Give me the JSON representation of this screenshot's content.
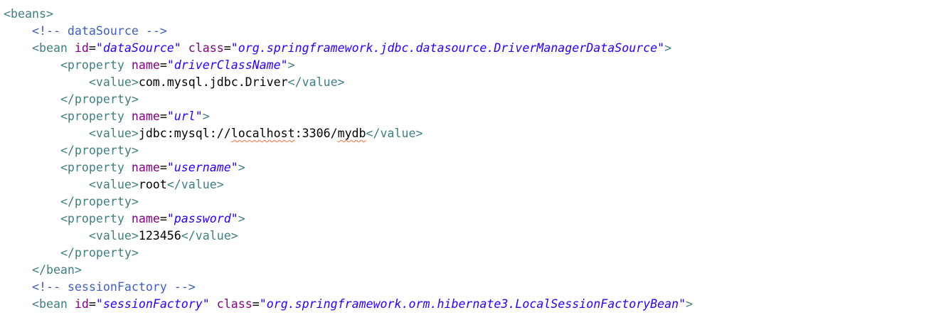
{
  "editor": {
    "lines": [
      [
        {
          "t": "tag",
          "v": "<beans>"
        }
      ],
      [
        {
          "t": "ws",
          "v": "    "
        },
        {
          "t": "comment",
          "v": "<!-- dataSource -->"
        }
      ],
      [
        {
          "t": "ws",
          "v": "    "
        },
        {
          "t": "tag",
          "v": "<bean "
        },
        {
          "t": "attr",
          "v": "id"
        },
        {
          "t": "text",
          "v": "="
        },
        {
          "t": "str",
          "v": "\"dataSource\""
        },
        {
          "t": "ws",
          "v": " "
        },
        {
          "t": "attr",
          "v": "class"
        },
        {
          "t": "text",
          "v": "="
        },
        {
          "t": "str",
          "v": "\"org.springframework.jdbc.datasource.DriverManagerDataSource\""
        },
        {
          "t": "tag",
          "v": ">"
        }
      ],
      [
        {
          "t": "ws",
          "v": "        "
        },
        {
          "t": "tag",
          "v": "<property "
        },
        {
          "t": "attr",
          "v": "name"
        },
        {
          "t": "text",
          "v": "="
        },
        {
          "t": "str",
          "v": "\"driverClassName\""
        },
        {
          "t": "tag",
          "v": ">"
        }
      ],
      [
        {
          "t": "ws",
          "v": "            "
        },
        {
          "t": "tag",
          "v": "<value>"
        },
        {
          "t": "text",
          "v": "com.mysql.jdbc.Driver"
        },
        {
          "t": "tag",
          "v": "</value>"
        }
      ],
      [
        {
          "t": "ws",
          "v": "        "
        },
        {
          "t": "tag",
          "v": "</property>"
        }
      ],
      [
        {
          "t": "ws",
          "v": "        "
        },
        {
          "t": "tag",
          "v": "<property "
        },
        {
          "t": "attr",
          "v": "name"
        },
        {
          "t": "text",
          "v": "="
        },
        {
          "t": "str",
          "v": "\"url\""
        },
        {
          "t": "tag",
          "v": ">"
        }
      ],
      [
        {
          "t": "ws",
          "v": "            "
        },
        {
          "t": "tag",
          "v": "<value>"
        },
        {
          "t": "text",
          "v": "jdbc:mysql://"
        },
        {
          "t": "spell",
          "v": "localhost"
        },
        {
          "t": "text",
          "v": ":3306/"
        },
        {
          "t": "spell",
          "v": "mydb"
        },
        {
          "t": "tag",
          "v": "</value>"
        }
      ],
      [
        {
          "t": "ws",
          "v": "        "
        },
        {
          "t": "tag",
          "v": "</property>"
        }
      ],
      [
        {
          "t": "ws",
          "v": "        "
        },
        {
          "t": "tag",
          "v": "<property "
        },
        {
          "t": "attr",
          "v": "name"
        },
        {
          "t": "text",
          "v": "="
        },
        {
          "t": "str",
          "v": "\"username\""
        },
        {
          "t": "tag",
          "v": ">"
        }
      ],
      [
        {
          "t": "ws",
          "v": "            "
        },
        {
          "t": "tag",
          "v": "<value>"
        },
        {
          "t": "text",
          "v": "root"
        },
        {
          "t": "tag",
          "v": "</value>"
        }
      ],
      [
        {
          "t": "ws",
          "v": "        "
        },
        {
          "t": "tag",
          "v": "</property>"
        }
      ],
      [
        {
          "t": "ws",
          "v": "        "
        },
        {
          "t": "tag",
          "v": "<property "
        },
        {
          "t": "attr",
          "v": "name"
        },
        {
          "t": "text",
          "v": "="
        },
        {
          "t": "str",
          "v": "\"password\""
        },
        {
          "t": "tag",
          "v": ">"
        }
      ],
      [
        {
          "t": "ws",
          "v": "            "
        },
        {
          "t": "tag",
          "v": "<value>"
        },
        {
          "t": "text",
          "v": "123456"
        },
        {
          "t": "tag",
          "v": "</value>"
        }
      ],
      [
        {
          "t": "ws",
          "v": "        "
        },
        {
          "t": "tag",
          "v": "</property>"
        }
      ],
      [
        {
          "t": "ws",
          "v": "    "
        },
        {
          "t": "tag",
          "v": "</bean>"
        }
      ],
      [
        {
          "t": "ws",
          "v": "    "
        },
        {
          "t": "comment",
          "v": "<!-- sessionFactory -->"
        }
      ],
      [
        {
          "t": "ws",
          "v": "    "
        },
        {
          "t": "tag",
          "v": "<bean "
        },
        {
          "t": "attr",
          "v": "id"
        },
        {
          "t": "text",
          "v": "="
        },
        {
          "t": "str",
          "v": "\"sessionFactory\""
        },
        {
          "t": "ws",
          "v": " "
        },
        {
          "t": "attr",
          "v": "class"
        },
        {
          "t": "text",
          "v": "="
        },
        {
          "t": "str",
          "v": "\"org.springframework.orm.hibernate3.LocalSessionFactoryBean\""
        },
        {
          "t": "tag",
          "v": ">"
        }
      ]
    ]
  },
  "colors": {
    "tag": "#3f7f7f",
    "attribute": "#7f007f",
    "string": "#2a00ff",
    "comment": "#3f5fbf",
    "text": "#000000",
    "spellcheck": "#ff6a3d"
  }
}
